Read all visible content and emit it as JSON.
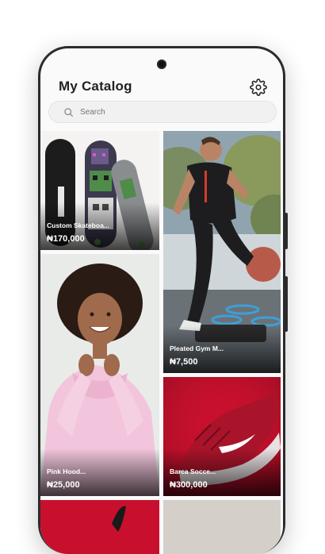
{
  "header": {
    "title": "My Catalog"
  },
  "search": {
    "placeholder": "Search"
  },
  "products": [
    {
      "name": "Custom Skateboa...",
      "price": "₦170,000"
    },
    {
      "name": "Pleated Gym M...",
      "price": "₦7,500"
    },
    {
      "name": "Pink Hood...",
      "price": "₦25,000"
    },
    {
      "name": "Barca Socce...",
      "price": "₦300,000"
    }
  ],
  "icons": {
    "settings": "gear-icon",
    "search": "search-icon"
  },
  "colors": {
    "background": "#fafafa",
    "frame": "#2b2b2d",
    "shoe_red": "#c8102e"
  }
}
